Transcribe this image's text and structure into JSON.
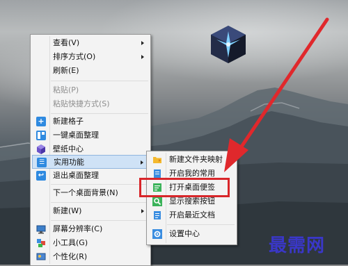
{
  "context_menu": {
    "items": [
      {
        "label": "查看(V)"
      },
      {
        "label": "排序方式(O)"
      },
      {
        "label": "刷新(E)"
      },
      {
        "label": "粘贴(P)"
      },
      {
        "label": "粘贴快捷方式(S)"
      },
      {
        "label": "新建格子"
      },
      {
        "label": "一键桌面整理"
      },
      {
        "label": "壁纸中心"
      },
      {
        "label": "实用功能"
      },
      {
        "label": "退出桌面整理"
      },
      {
        "label": "下一个桌面背景(N)"
      },
      {
        "label": "新建(W)"
      },
      {
        "label": "屏幕分辨率(C)"
      },
      {
        "label": "小工具(G)"
      },
      {
        "label": "个性化(R)"
      }
    ]
  },
  "submenu": {
    "items": [
      {
        "label": "新建文件夹映射"
      },
      {
        "label": "开启我的常用"
      },
      {
        "label": "打开桌面便签"
      },
      {
        "label": "显示搜索按钮"
      },
      {
        "label": "开启最近文档"
      },
      {
        "label": "设置中心"
      }
    ]
  },
  "watermark": "最需网",
  "colors": {
    "highlight_box": "#d8262a",
    "arrow": "#e0282c",
    "accent_blue": "#2f8ae0",
    "watermark": "#3a37c8"
  }
}
